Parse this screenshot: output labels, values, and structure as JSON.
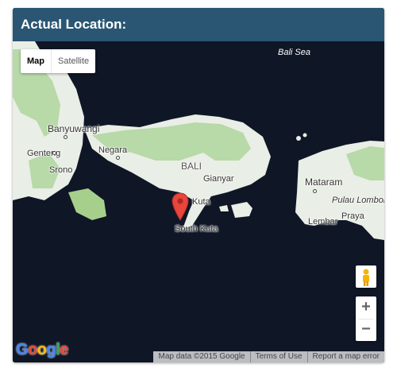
{
  "panel": {
    "title": "Actual Location:"
  },
  "map": {
    "map_type": {
      "map_label": "Map",
      "satellite_label": "Satellite",
      "selected": "Map"
    },
    "labels": {
      "bali_sea": "Bali Sea",
      "banyuwangi": "Banyuwangi",
      "genteng": "Genteng",
      "srono": "Srono",
      "negara": "Negara",
      "bali": "BALI",
      "gianyar": "Gianyar",
      "kuta": "Kuta",
      "south_kuta": "South Kuta",
      "mataram": "Mataram",
      "pulau_lombok": "Pulau Lombok",
      "praya": "Praya",
      "lembar": "Lembar"
    },
    "controls": {
      "zoom_in": "+",
      "zoom_out": "−"
    },
    "logo_text": "Google",
    "attribution": {
      "data": "Map data ©2015 Google",
      "terms": "Terms of Use",
      "report": "Report a map error"
    },
    "colors": {
      "water": "#0f1626",
      "land": "#e9eee6",
      "forest": "#b8d9a8",
      "header": "#2a5673",
      "marker": "#e8453c"
    }
  }
}
